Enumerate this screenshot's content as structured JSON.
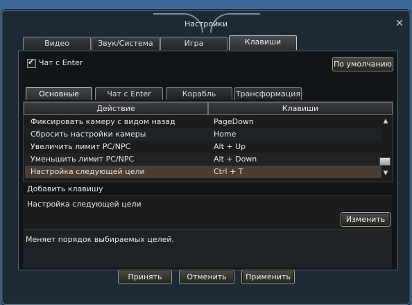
{
  "window": {
    "title": "Настройки",
    "close_label": "✕"
  },
  "main_tabs": [
    {
      "label": "Видео",
      "active": false
    },
    {
      "label": "Звук/Система",
      "active": false
    },
    {
      "label": "Игра",
      "active": false
    },
    {
      "label": "Клавиши",
      "active": true
    }
  ],
  "chat_checkbox": {
    "label": "Чат с Enter",
    "checked": true
  },
  "default_button": "По умолчанию",
  "sub_tabs": [
    {
      "label": "Основные",
      "active": true
    },
    {
      "label": "Чат с Enter",
      "active": false
    },
    {
      "label": "Корабль",
      "active": false
    },
    {
      "label": "Трансформация",
      "active": false
    }
  ],
  "table": {
    "headers": {
      "action": "Действие",
      "keys": "Клавиши"
    },
    "rows": [
      {
        "action": "Фиксировать камеру с видом назад",
        "key": "PageDown"
      },
      {
        "action": "Сбросить настройки камеры",
        "key": "Home"
      },
      {
        "action": "Увеличить лимит PC/NPC",
        "key": "Alt + Up"
      },
      {
        "action": "Уменьшить лимит PC/NPC",
        "key": "Alt + Down"
      },
      {
        "action": "Настройка следующей цели",
        "key": "Ctrl + T",
        "selected": true
      }
    ]
  },
  "add_key_label": "Добавить клавишу",
  "selected_action": "Настройка следующей цели",
  "change_button": "Изменить",
  "description": "Меняет порядок выбираемых целей.",
  "footer": {
    "accept": "Принять",
    "cancel": "Отменить",
    "apply": "Применить"
  },
  "colors": {
    "background": "#3c6a98",
    "selected_row": "#4a3d33",
    "window": "#1d2a36"
  }
}
